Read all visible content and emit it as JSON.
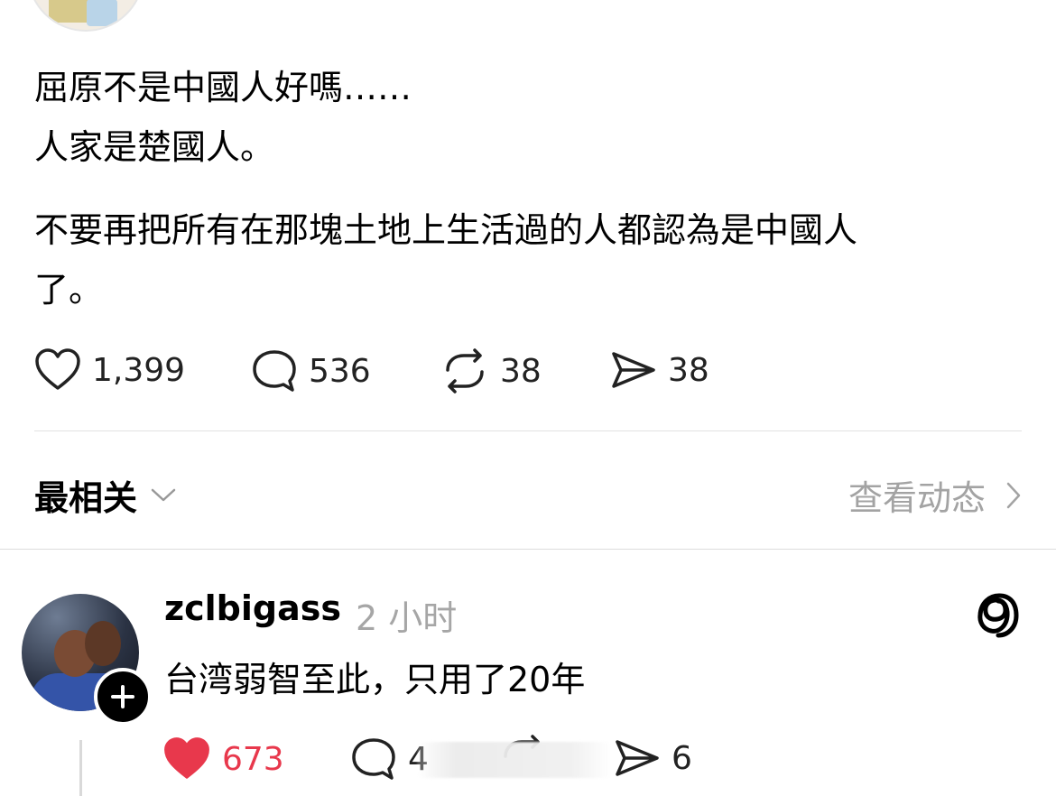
{
  "post": {
    "lines": [
      "屈原不是中國人好嗎……",
      "人家是楚國人。",
      "不要再把所有在那塊土地上生活過的人都認為是中國人",
      "了。"
    ],
    "actions": {
      "likes": "1,399",
      "comments": "536",
      "reposts": "38",
      "shares": "38"
    }
  },
  "replies_header": {
    "sort_label": "最相关",
    "activity_label": "查看动态"
  },
  "reply": {
    "username": "zclbigass",
    "time": "2 小时",
    "text": "台湾弱智至此，只用了20年",
    "actions": {
      "likes": "673",
      "comments": "4",
      "shares": "6"
    },
    "like_color": "#e8384c"
  },
  "icons": [
    "heart-icon",
    "comment-icon",
    "repost-icon",
    "share-icon",
    "chevron-down-icon",
    "chevron-right-icon",
    "plus-icon",
    "threads-logo-icon"
  ]
}
